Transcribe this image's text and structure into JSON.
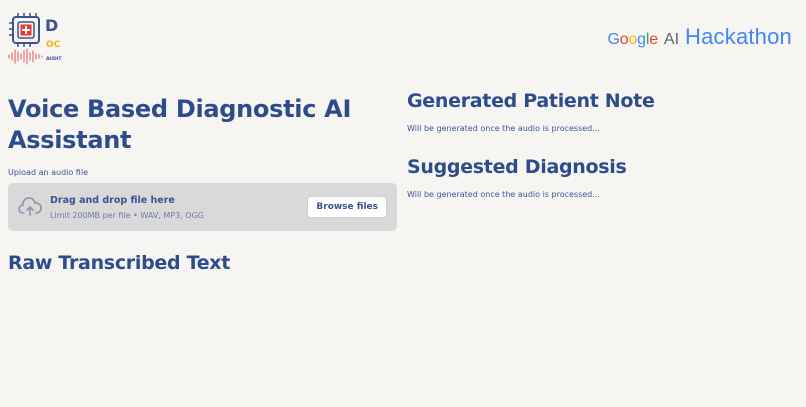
{
  "logo": {
    "letters": [
      "D",
      "OC",
      "AUDIT"
    ],
    "name": "doc-audit-logo"
  },
  "brand": {
    "google": [
      "G",
      "o",
      "o",
      "g",
      "l",
      "e"
    ],
    "ai": "AI",
    "hackathon": "Hackathon"
  },
  "main": {
    "title": "Voice Based Diagnostic AI Assistant",
    "upload_label": "Upload an audio file",
    "dropzone": {
      "title": "Drag and drop file here",
      "limit": "Limit 200MB per file • WAV, MP3, OGG",
      "browse_label": "Browse files",
      "icon": "cloud-upload-icon"
    },
    "raw_title": "Raw Transcribed Text"
  },
  "right": {
    "note_title": "Generated Patient Note",
    "note_placeholder": "Will be generated once the audio is processed...",
    "diagnosis_title": "Suggested Diagnosis",
    "diagnosis_placeholder": "Will be generated once the audio is processed..."
  },
  "colors": {
    "background": "#f6f5f2",
    "heading": "#2e4c8c",
    "dropzone": "#d9d9d9",
    "hackathon_blue": "#4285f4"
  }
}
